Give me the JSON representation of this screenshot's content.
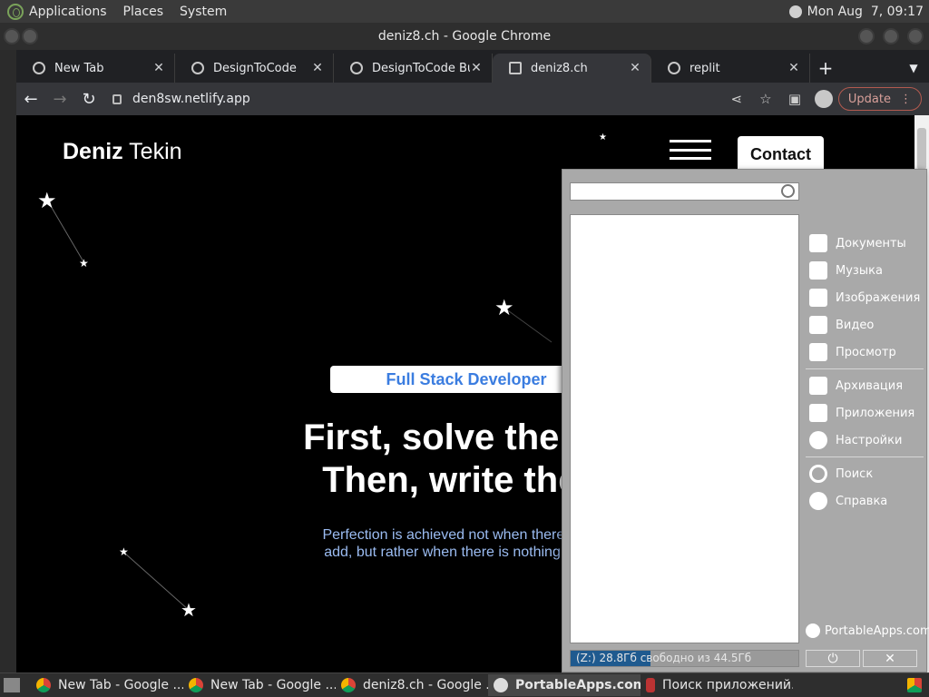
{
  "topbar": {
    "menus": [
      "Applications",
      "Places",
      "System"
    ],
    "clock": "Mon Aug  7, 09:17"
  },
  "window": {
    "title": "deniz8.ch - Google Chrome"
  },
  "tabs": [
    {
      "label": "New Tab",
      "active": false
    },
    {
      "label": "DesignToCode",
      "active": false
    },
    {
      "label": "DesignToCode Buil",
      "active": false
    },
    {
      "label": "deniz8.ch",
      "active": true
    },
    {
      "label": "replit",
      "active": false
    }
  ],
  "toolbar": {
    "url": "den8sw.netlify.app",
    "update_label": "Update"
  },
  "site": {
    "brand_bold": "Deniz",
    "brand_rest": " Tekin",
    "contact": "Contact",
    "badge": "Full Stack Developer",
    "hero_line1": "First, solve the pro",
    "hero_line2": "Then, write the c",
    "quote_line1": "Perfection is achieved not when there is no",
    "quote_line2": "add, but rather when there is nothing more"
  },
  "portableapps": {
    "menu": [
      "Документы",
      "Музыка",
      "Изображения",
      "Видео",
      "Просмотр",
      "Архивация",
      "Приложения",
      "Настройки",
      "Поиск",
      "Справка"
    ],
    "brand": "PortableApps.com",
    "status": "(Z:) 28.8Гб свободно из 44.5Гб",
    "free_fraction": 0.35
  },
  "taskbar": [
    {
      "label": "New Tab - Google ...",
      "active": false
    },
    {
      "label": "New Tab - Google ...",
      "active": false
    },
    {
      "label": "deniz8.ch - Google ...",
      "active": false
    },
    {
      "label": "PortableApps.com ...",
      "active": true
    },
    {
      "label": "Поиск приложений...",
      "active": false
    }
  ]
}
